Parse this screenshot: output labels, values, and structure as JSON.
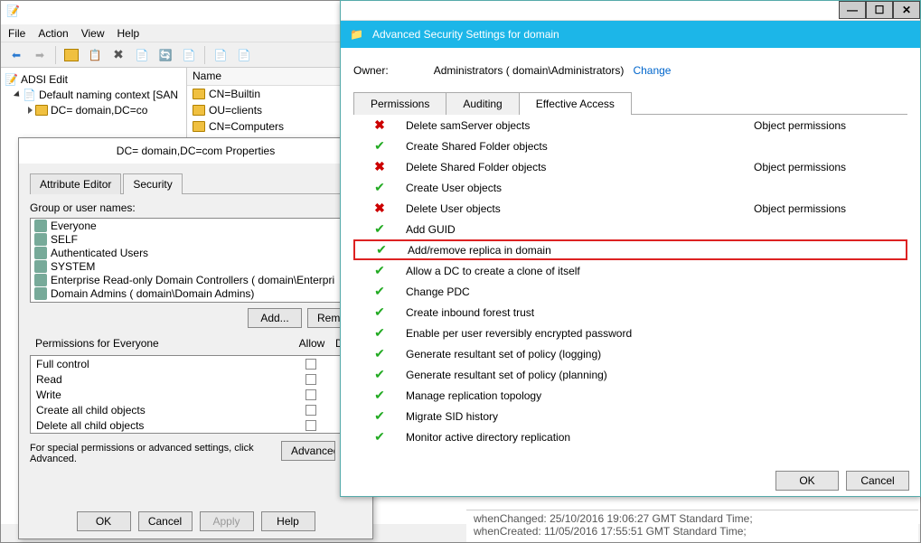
{
  "adsi": {
    "title": "ADSI Edit",
    "menu": {
      "file": "File",
      "action": "Action",
      "view": "View",
      "help": "Help"
    },
    "tree": {
      "root": "ADSI Edit",
      "ctx": "Default naming context [SAN",
      "dc": "DC=         domain,DC=co"
    },
    "list": {
      "header": "Name",
      "items": [
        "CN=Builtin",
        "OU=clients",
        "CN=Computers"
      ]
    }
  },
  "props": {
    "title": "DC=         domain,DC=com Properties",
    "tab1": "Attribute Editor",
    "tab2": "Security",
    "groups_label": "Group or user names:",
    "groups": [
      "Everyone",
      "SELF",
      "Authenticated Users",
      "SYSTEM",
      "Enterprise Read-only Domain Controllers (       domain\\Enterpri",
      "Domain Admins (       domain\\Domain Admins)"
    ],
    "add": "Add...",
    "remove": "Remove",
    "perms_label": "Permissions for Everyone",
    "col_allow": "Allow",
    "col_deny": "Deny",
    "perms": [
      "Full control",
      "Read",
      "Write",
      "Create all child objects",
      "Delete all child objects"
    ],
    "adv_text": "For special permissions or advanced settings, click Advanced.",
    "adv_btn": "Advanced",
    "ok": "OK",
    "cancel": "Cancel",
    "apply": "Apply",
    "help": "Help"
  },
  "adv": {
    "title": "Advanced Security Settings for          domain",
    "owner_label": "Owner:",
    "owner_value": "Administrators (       domain\\Administrators)",
    "change": "Change",
    "tab_perm": "Permissions",
    "tab_audit": "Auditing",
    "tab_eff": "Effective Access",
    "rows": [
      {
        "icon": "x",
        "name": "Delete samServer objects",
        "limit": "Object permissions"
      },
      {
        "icon": "c",
        "name": "Create Shared Folder objects",
        "limit": ""
      },
      {
        "icon": "x",
        "name": "Delete Shared Folder objects",
        "limit": "Object permissions"
      },
      {
        "icon": "c",
        "name": "Create User objects",
        "limit": ""
      },
      {
        "icon": "x",
        "name": "Delete User objects",
        "limit": "Object permissions"
      },
      {
        "icon": "c",
        "name": "Add GUID",
        "limit": ""
      },
      {
        "icon": "c",
        "name": "Add/remove replica in domain",
        "limit": "",
        "hl": true
      },
      {
        "icon": "c",
        "name": "Allow a DC to create a clone of itself",
        "limit": ""
      },
      {
        "icon": "c",
        "name": "Change PDC",
        "limit": ""
      },
      {
        "icon": "c",
        "name": "Create inbound forest trust",
        "limit": ""
      },
      {
        "icon": "c",
        "name": "Enable per user reversibly encrypted password",
        "limit": ""
      },
      {
        "icon": "c",
        "name": "Generate resultant set of policy (logging)",
        "limit": ""
      },
      {
        "icon": "c",
        "name": "Generate resultant set of policy (planning)",
        "limit": ""
      },
      {
        "icon": "c",
        "name": "Manage replication topology",
        "limit": ""
      },
      {
        "icon": "c",
        "name": "Migrate SID history",
        "limit": ""
      },
      {
        "icon": "c",
        "name": "Monitor active directory replication",
        "limit": ""
      }
    ],
    "ok": "OK",
    "cancel": "Cancel"
  },
  "attrs": {
    "l1": "whenChanged: 25/10/2016 19:06:27 GMT Standard Time;",
    "l2": "whenCreated: 11/05/2016 17:55:51 GMT Standard Time;"
  }
}
